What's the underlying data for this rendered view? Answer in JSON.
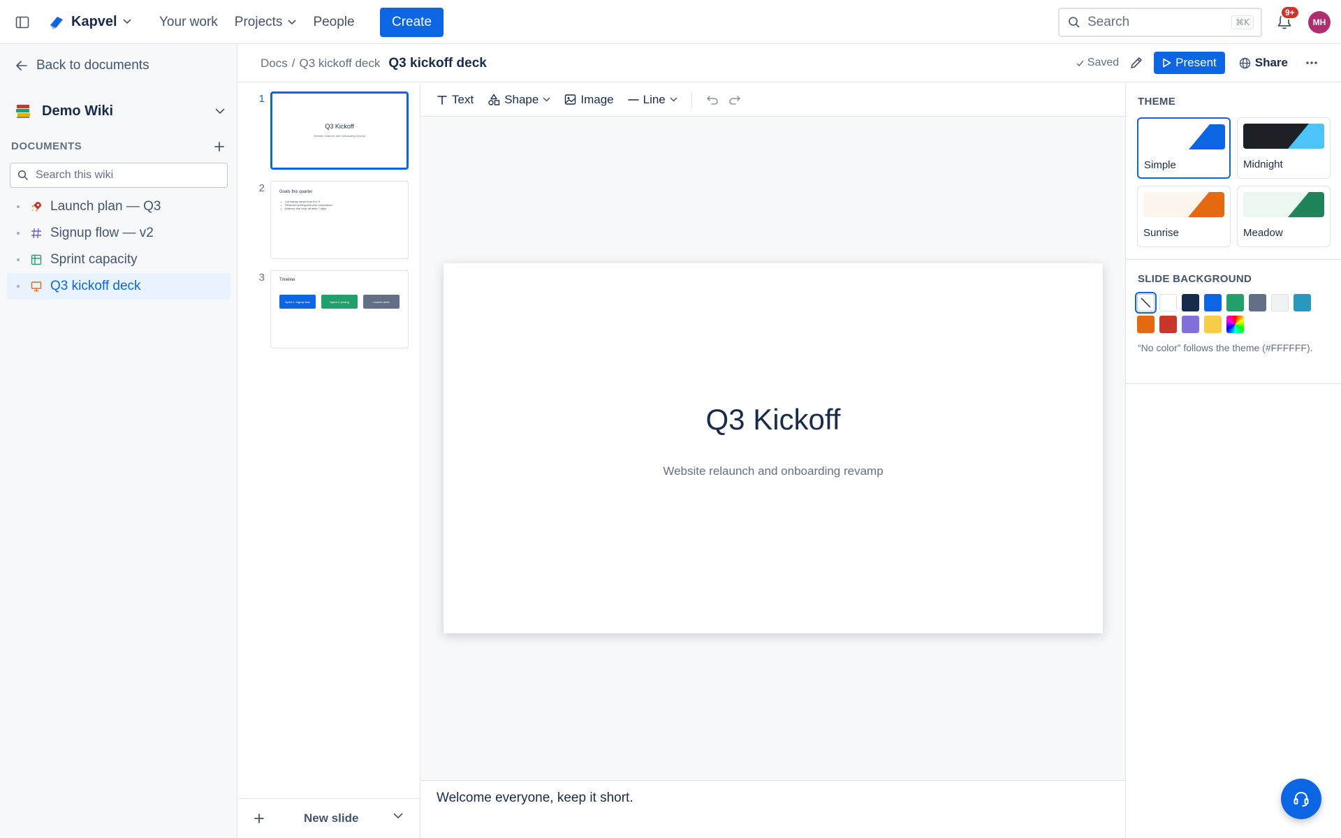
{
  "topbar": {
    "app_name": "Kapvel",
    "nav": [
      "Your work",
      "Projects",
      "People"
    ],
    "create_label": "Create",
    "search_placeholder": "Search",
    "search_shortcut": "⌘K",
    "notif_badge": "9+",
    "avatar_initials": "MH",
    "accent": "#0c66e4"
  },
  "sidebar": {
    "back_label": "Back to documents",
    "space_name": "Demo Wiki",
    "section_title": "DOCUMENTS",
    "search_placeholder": "Search this wiki",
    "items": [
      {
        "label": "Launch plan — Q3",
        "icon": "rocket-icon"
      },
      {
        "label": "Signup flow — v2",
        "icon": "hash-icon"
      },
      {
        "label": "Sprint capacity",
        "icon": "table-icon"
      },
      {
        "label": "Q3 kickoff deck",
        "icon": "presentation-icon",
        "active": true
      }
    ]
  },
  "doc_header": {
    "crumb_root": "Docs",
    "crumb_sep": "/",
    "crumb_doc": "Q3 kickoff deck",
    "title": "Q3 kickoff deck",
    "saved_label": "Saved",
    "present_label": "Present",
    "share_label": "Share"
  },
  "thumbnails": {
    "numbers": [
      "1",
      "2",
      "3"
    ],
    "s1": {
      "title": "Q3 Kickoff",
      "subtitle": "Website relaunch and onboarding revamp"
    },
    "s2": {
      "title": "Goals this quarter",
      "bullets": [
        "Cut signup steps from 6 to 3",
        "Relaunch pricing with plan comparison",
        "Address trial drop-off after 7 days"
      ]
    },
    "s3": {
      "title": "Timeline",
      "boxes": [
        {
          "label": "Sprint 1: signup flow",
          "color": "#0c66e4"
        },
        {
          "label": "Sprint 2: pricing",
          "color": "#22a06b"
        },
        {
          "label": "Launch week",
          "color": "#626f86"
        }
      ]
    },
    "new_slide_label": "New slide"
  },
  "toolbar": {
    "text_label": "Text",
    "shape_label": "Shape",
    "image_label": "Image",
    "line_label": "Line"
  },
  "slide": {
    "title": "Q3 Kickoff",
    "subtitle": "Website relaunch and onboarding revamp"
  },
  "notes": "Welcome everyone, keep it short.",
  "right_panel": {
    "theme_title": "THEME",
    "themes": [
      {
        "name": "Simple",
        "bg": "#ffffff",
        "accent": "#0c66e4",
        "selected": true
      },
      {
        "name": "Midnight",
        "bg": "#1d2125",
        "accent": "#4cc3f9"
      },
      {
        "name": "Sunrise",
        "bg": "#fdf6ec",
        "accent": "#e56910"
      },
      {
        "name": "Meadow",
        "bg": "#ebf8f1",
        "accent": "#1f845a"
      }
    ],
    "bg_title": "SLIDE BACKGROUND",
    "bg_colors": [
      "none",
      "#ffffff",
      "#172b4d",
      "#0c66e4",
      "#22a06b",
      "#626f86",
      "#f1f2f4",
      "#2898bd",
      "#e56910",
      "#c9372c",
      "#8270db",
      "#f5cd47",
      "rainbow"
    ],
    "bg_note": "“No color” follows the theme (#FFFFFF)."
  }
}
